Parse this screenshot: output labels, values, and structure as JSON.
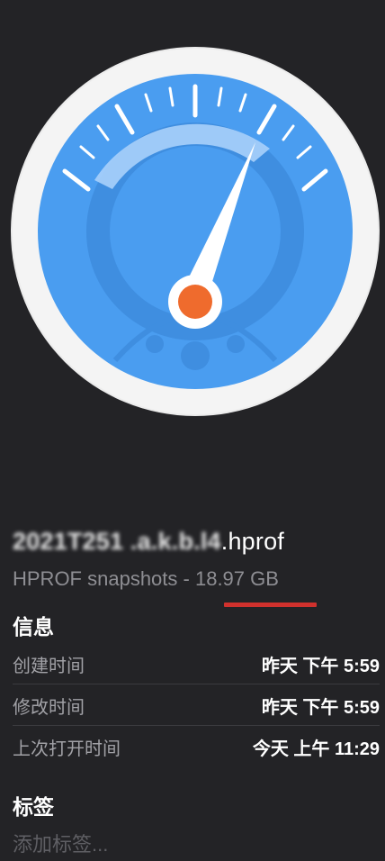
{
  "file": {
    "name_obscured": "2021T251 .a.k.b.l4",
    "name_extension": ".hprof",
    "kind": "HPROF snapshots",
    "separator": " - ",
    "size": "18.97 GB"
  },
  "info": {
    "title": "信息",
    "rows": [
      {
        "label": "创建时间",
        "value": "昨天 下午 5:59"
      },
      {
        "label": "修改时间",
        "value": "昨天 下午 5:59"
      },
      {
        "label": "上次打开时间",
        "value": "今天 上午 11:29"
      }
    ]
  },
  "tags": {
    "title": "标签",
    "placeholder": "添加标签..."
  },
  "icon": {
    "name": "speedometer-icon",
    "colors": {
      "rim": "#f2f2f2",
      "dial": "#4a9df0",
      "needle": "#ffffff",
      "hub": "#ef6b2d",
      "accent_underline": "#d0312d"
    }
  }
}
